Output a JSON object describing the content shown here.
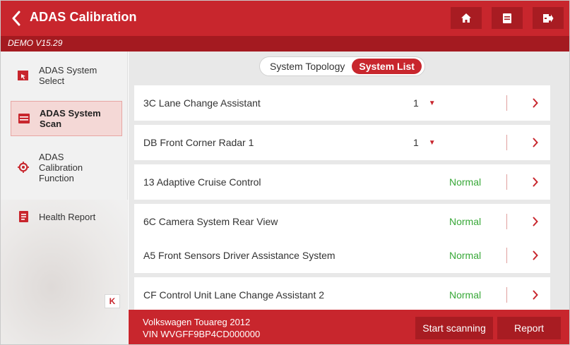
{
  "header": {
    "title": "ADAS Calibration",
    "back_icon": "back-chevron-icon",
    "actions": [
      {
        "name": "home-button",
        "icon": "home-icon"
      },
      {
        "name": "print-button",
        "icon": "printer-icon"
      },
      {
        "name": "exit-button",
        "icon": "exit-icon"
      }
    ]
  },
  "subheader": {
    "version": "DEMO V15.29"
  },
  "sidebar": {
    "items": [
      {
        "label": "ADAS System\nSelect",
        "icon": "system-select-icon",
        "active": false
      },
      {
        "label": "ADAS System\nScan",
        "icon": "system-scan-icon",
        "active": true
      },
      {
        "label": "ADAS\nCalibration\nFunction",
        "icon": "calibration-target-icon",
        "active": false
      },
      {
        "label": "Health Report",
        "icon": "report-icon",
        "active": false
      }
    ],
    "collapse_glyph": "K"
  },
  "tabs": [
    {
      "label": "System Topology",
      "active": false
    },
    {
      "label": "System List",
      "active": true
    }
  ],
  "systems": [
    {
      "name": "3C Lane Change Assistant",
      "status": "1",
      "has_dropdown": true
    },
    {
      "name": "DB Front Corner Radar 1",
      "status": "1",
      "has_dropdown": true
    },
    {
      "name": "13 Adaptive Cruise Control",
      "status": "Normal",
      "has_dropdown": false
    },
    {
      "name": "6C Camera System Rear View",
      "status": "Normal",
      "has_dropdown": false
    },
    {
      "name": "A5 Front Sensors Driver Assistance System",
      "status": "Normal",
      "has_dropdown": false
    },
    {
      "name": "CF Control Unit Lane Change Assistant 2",
      "status": "Normal",
      "has_dropdown": false
    }
  ],
  "vehicle": {
    "model": "Volkswagen Touareg 2012",
    "vin": "VIN WVGFF9BP4CD000000"
  },
  "buttons": {
    "start_scanning": "Start scanning",
    "report": "Report"
  },
  "colors": {
    "brand_red": "#c8262d",
    "dark_red": "#a81c22",
    "normal_green": "#38a838"
  }
}
